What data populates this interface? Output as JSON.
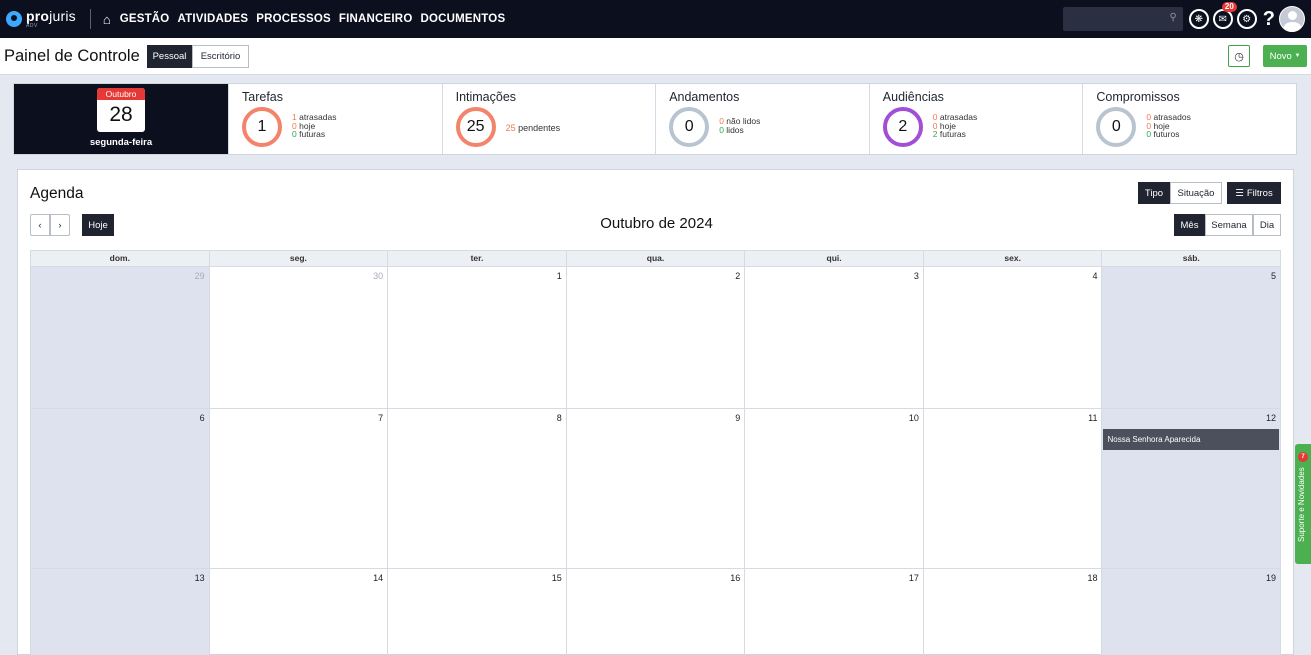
{
  "app": {
    "brand_bold": "pro",
    "brand_light": "juris",
    "brand_sub": "ADV"
  },
  "nav": {
    "items": [
      "GESTÃO",
      "ATIVIDADES",
      "PROCESSOS",
      "FINANCEIRO",
      "DOCUMENTOS"
    ]
  },
  "top_right": {
    "notification_count": "20",
    "help_label": "?"
  },
  "header": {
    "title": "Painel de Controle",
    "tab_pessoal": "Pessoal",
    "tab_escritorio": "Escritório",
    "novo_label": "Novo"
  },
  "date_card": {
    "month": "Outubro",
    "day": "28",
    "weekday": "segunda-feira"
  },
  "stats": {
    "tarefas": {
      "title": "Tarefas",
      "count": "1",
      "l1_num": "1",
      "l1_text": "atrasadas",
      "l2_num": "0",
      "l2_text": "hoje",
      "l3_num": "0",
      "l3_text": "futuras"
    },
    "intimacoes": {
      "title": "Intimações",
      "count": "25",
      "num": "25",
      "text": "pendentes"
    },
    "andamentos": {
      "title": "Andamentos",
      "count": "0",
      "l1_num": "0",
      "l1_text": "não lidos",
      "l2_num": "0",
      "l2_text": "lidos"
    },
    "audiencias": {
      "title": "Audiências",
      "count": "2",
      "l1_num": "0",
      "l1_text": "atrasadas",
      "l2_num": "0",
      "l2_text": "hoje",
      "l3_num": "2",
      "l3_text": "futuras"
    },
    "compromissos": {
      "title": "Compromissos",
      "count": "0",
      "l1_num": "0",
      "l1_text": "atrasados",
      "l2_num": "0",
      "l2_text": "hoje",
      "l3_num": "0",
      "l3_text": "futuros"
    }
  },
  "agenda": {
    "title": "Agenda",
    "month_title": "Outubro de 2024",
    "btn_tipo": "Tipo",
    "btn_situacao": "Situação",
    "btn_filtros": "Filtros",
    "btn_hoje": "Hoje",
    "btn_prev": "‹",
    "btn_next": "›",
    "view_mes": "Mês",
    "view_semana": "Semana",
    "view_dia": "Dia",
    "weekdays": [
      "dom.",
      "seg.",
      "ter.",
      "qua.",
      "qui.",
      "sex.",
      "sáb."
    ],
    "weeks": [
      [
        "29",
        "30",
        "1",
        "2",
        "3",
        "4",
        "5"
      ],
      [
        "6",
        "7",
        "8",
        "9",
        "10",
        "11",
        "12"
      ],
      [
        "13",
        "14",
        "15",
        "16",
        "17",
        "18",
        "19"
      ]
    ],
    "event_12": "Nossa Senhora Aparecida"
  },
  "support": {
    "label": "Suporte e Novidades",
    "badge": "7"
  },
  "icons": {
    "home": "home-icon",
    "search": "search-icon",
    "settings": "gear-icon",
    "history": "clock-icon",
    "filters": "sliders-icon",
    "avatar": "user-avatar"
  }
}
